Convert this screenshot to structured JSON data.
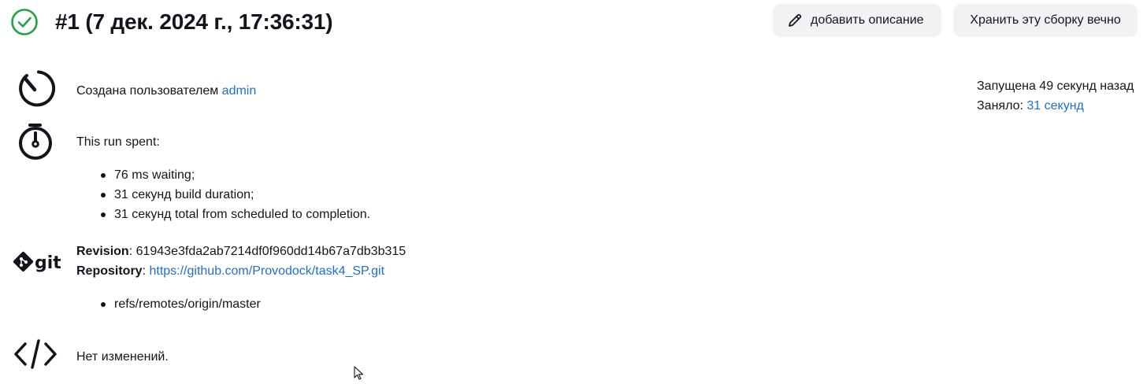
{
  "header": {
    "status_icon": "check-circle-icon",
    "status_color": "#1ea446",
    "title": "#1 (7 дек. 2024 г., 17:36:31)",
    "add_description_label": "добавить описание",
    "keep_forever_label": "Хранить эту сборку вечно"
  },
  "cause": {
    "icon": "dial-icon",
    "text": "Создана пользователем ",
    "user": "admin"
  },
  "timing": {
    "icon": "stopwatch-icon",
    "heading": "This run spent:",
    "items": [
      "76 ms waiting;",
      "31 секунд build duration;",
      "31 секунд total from scheduled to completion."
    ]
  },
  "git": {
    "icon": "git-logo-icon",
    "revision_label": "Revision",
    "revision_value": ": 61943e3fda2ab7214df0f960dd14b67a7db3b315",
    "repository_label": "Repository",
    "repository_sep": ": ",
    "repository_url": "https://github.com/Provodock/task4_SP.git",
    "refs": [
      "refs/remotes/origin/master"
    ]
  },
  "changes": {
    "icon": "code-icon",
    "text": "Нет изменений."
  },
  "side": {
    "started": "Запущена 49 секунд назад",
    "duration_label": "Заняло: ",
    "duration_value": "31 секунд"
  },
  "accent_color": "#1e6fcf"
}
